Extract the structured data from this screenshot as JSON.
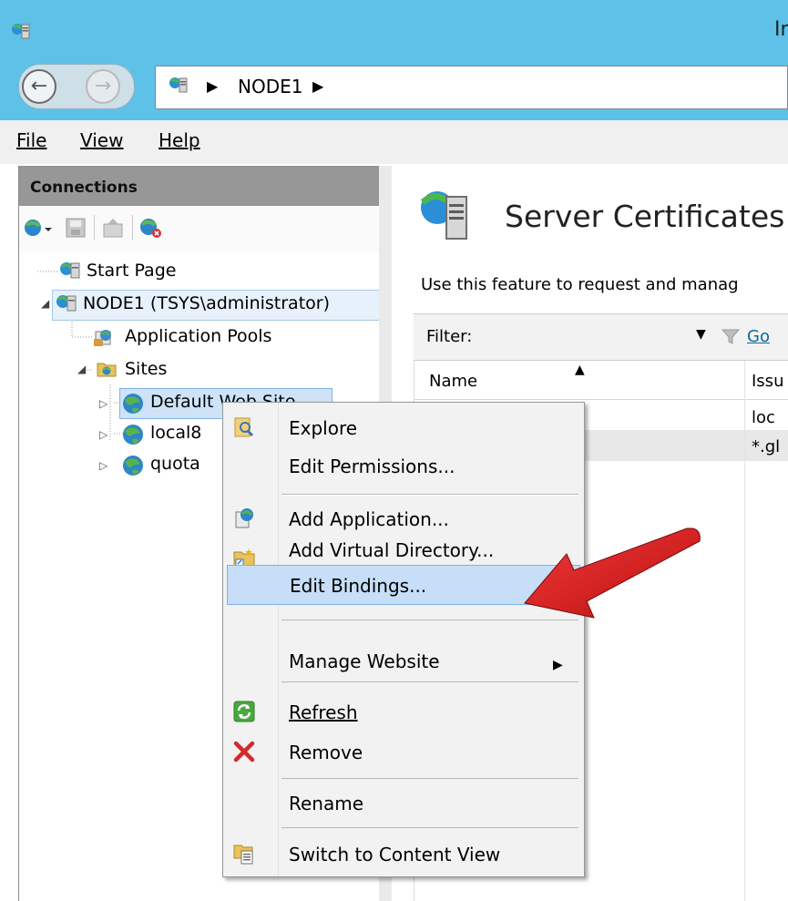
{
  "window": {
    "title": "Ir"
  },
  "address_bar": {
    "separator": "▶",
    "path": [
      "NODE1"
    ]
  },
  "menu": {
    "items": [
      "File",
      "View",
      "Help"
    ]
  },
  "connections": {
    "header": "Connections",
    "tree": [
      {
        "label": "Start Page",
        "icon": "start-page-icon"
      },
      {
        "label": "NODE1 (TSYS\\administrator)",
        "icon": "server-icon",
        "expanded": true
      },
      {
        "label": "Application Pools",
        "icon": "app-pool-icon"
      },
      {
        "label": "Sites",
        "icon": "sites-folder-icon",
        "expanded": true
      },
      {
        "label": "Default Web Site",
        "icon": "globe-icon",
        "selected": true
      },
      {
        "label": "local8",
        "icon": "globe-icon"
      },
      {
        "label": "quota",
        "icon": "globe-icon"
      }
    ]
  },
  "feature": {
    "title": "Server Certificates",
    "description": "Use this feature to request and manag",
    "filter_label": "Filter:",
    "go_label": "Go",
    "columns": [
      "Name",
      "Issu"
    ],
    "rows": [
      {
        "name": "",
        "issued": "loc"
      },
      {
        "name": "",
        "issued": "*.gl"
      }
    ]
  },
  "context_menu": {
    "items": [
      {
        "label": "Explore",
        "icon": "explore-icon"
      },
      {
        "label": "Edit Permissions...",
        "icon": ""
      },
      {
        "label": "Add Application...",
        "icon": "add-application-icon"
      },
      {
        "label": "Add Virtual Directory...",
        "icon": "add-virtual-directory-icon"
      },
      {
        "label": "Edit Bindings...",
        "icon": "",
        "highlighted": true
      },
      {
        "label": "Manage Website",
        "icon": "",
        "submenu": true,
        "submenu_arrow": "▶"
      },
      {
        "label": "Refresh",
        "icon": "refresh-icon"
      },
      {
        "label": "Remove",
        "icon": "remove-icon"
      },
      {
        "label": "Rename",
        "icon": ""
      },
      {
        "label": "Switch to Content View",
        "icon": "content-view-icon"
      }
    ]
  },
  "annotation": {
    "arrow_color": "#e01c1c"
  },
  "colors": {
    "titlebar": "#5ec1e8",
    "highlight": "#c6def7",
    "connections_header": "#979797"
  }
}
